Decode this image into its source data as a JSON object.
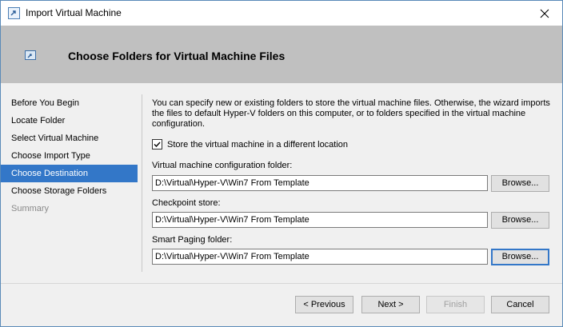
{
  "window": {
    "title": "Import Virtual Machine"
  },
  "header": {
    "title": "Choose Folders for Virtual Machine Files"
  },
  "nav": {
    "items": [
      {
        "label": "Before You Begin",
        "state": "normal"
      },
      {
        "label": "Locate Folder",
        "state": "normal"
      },
      {
        "label": "Select Virtual Machine",
        "state": "normal"
      },
      {
        "label": "Choose Import Type",
        "state": "normal"
      },
      {
        "label": "Choose Destination",
        "state": "active"
      },
      {
        "label": "Choose Storage Folders",
        "state": "normal"
      },
      {
        "label": "Summary",
        "state": "disabled"
      }
    ]
  },
  "content": {
    "description": "You can specify new or existing folders to store the virtual machine files. Otherwise, the wizard imports the files to default Hyper-V folders on this computer, or to folders specified in the virtual machine configuration.",
    "store_checkbox": {
      "label": "Store the virtual machine in a different location",
      "checked": true
    },
    "fields": [
      {
        "label": "Virtual machine configuration folder:",
        "value": "D:\\Virtual\\Hyper-V\\Win7 From Template",
        "browse": "Browse..."
      },
      {
        "label": "Checkpoint store:",
        "value": "D:\\Virtual\\Hyper-V\\Win7 From Template",
        "browse": "Browse..."
      },
      {
        "label": "Smart Paging folder:",
        "value": "D:\\Virtual\\Hyper-V\\Win7 From Template",
        "browse": "Browse..."
      }
    ]
  },
  "footer": {
    "previous": "< Previous",
    "next": "Next >",
    "finish": "Finish",
    "cancel": "Cancel"
  },
  "colors": {
    "accent": "#3377c8",
    "header_band": "#c0c0c0",
    "background": "#f0f0f0"
  }
}
